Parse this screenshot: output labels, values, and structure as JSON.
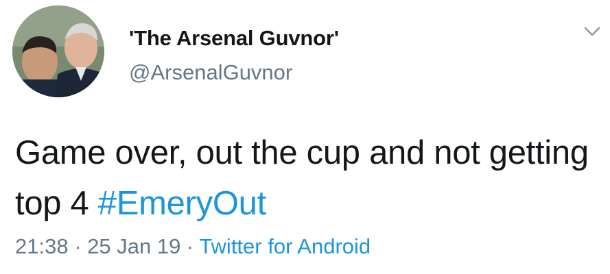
{
  "tweet": {
    "display_name": "'The Arsenal Guvnor'",
    "handle": "@ArsenalGuvnor",
    "text_before": "Game over, out the cup and not getting top 4 ",
    "hashtag": "#EmeryOut",
    "time": "21:38",
    "separator": " · ",
    "date": "25 Jan 19",
    "source": "Twitter for Android"
  },
  "icons": {
    "menu": "chevron-down-icon",
    "avatar": "avatar"
  },
  "colors": {
    "text": "#14171a",
    "secondary": "#657786",
    "link": "#1b95e0",
    "background": "#ffffff"
  }
}
